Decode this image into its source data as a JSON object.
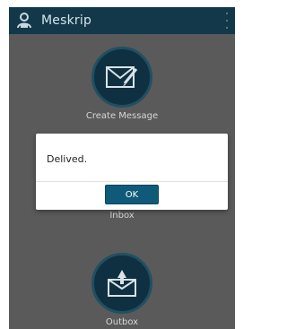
{
  "app": {
    "title": "Meskrip",
    "icons": {
      "logo": "user-phone-icon",
      "menu": "overflow-menu-icon"
    }
  },
  "tiles": [
    {
      "label": "Create Message",
      "icon": "compose-envelope-icon"
    },
    {
      "label": "Inbox",
      "icon": "inbox-icon"
    },
    {
      "label": "Outbox",
      "icon": "outbox-icon"
    }
  ],
  "dialog": {
    "message": "Delived.",
    "ok_label": "OK"
  },
  "colors": {
    "appbar": "#12384a",
    "background": "#5a5a5a",
    "circle": "#0f3040",
    "button": "#0f5a78"
  }
}
